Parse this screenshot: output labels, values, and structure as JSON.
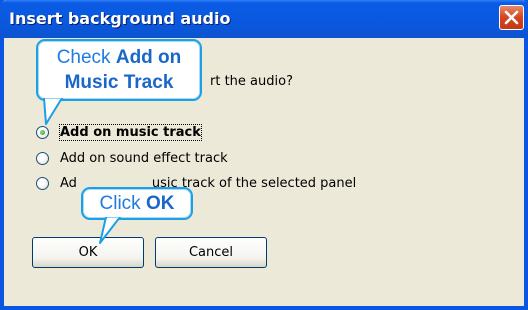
{
  "window": {
    "title": "Insert background audio",
    "close_icon": "close-icon"
  },
  "dialog": {
    "question": "rt the audio?",
    "options": [
      {
        "label": "Add on music track",
        "checked": true
      },
      {
        "label": "Add on sound effect track",
        "checked": false
      },
      {
        "label": "Ad",
        "label_tail": "usic track of the selected panel",
        "checked": false
      }
    ],
    "ok_label": "OK",
    "cancel_label": "Cancel"
  },
  "callouts": {
    "top": {
      "line1_prefix": "Check ",
      "line1_bold": "Add on",
      "line2": "Music Track"
    },
    "bottom": {
      "prefix": "Click ",
      "bold": "OK"
    }
  },
  "colors": {
    "titlebar": "#0a58df",
    "callout_border": "#1d9fe7",
    "callout_text": "#1f7be0"
  }
}
